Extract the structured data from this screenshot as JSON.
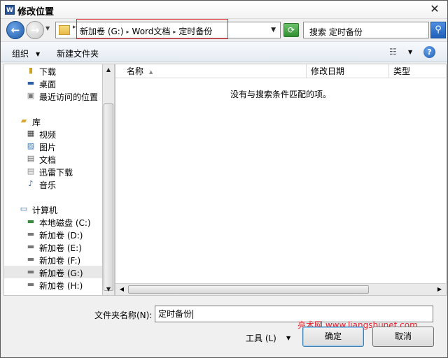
{
  "window": {
    "title": "修改位置",
    "app_icon_text": "W"
  },
  "address": {
    "crumbs": [
      "新加卷 (G:)",
      "Word文档",
      "定时备份"
    ]
  },
  "search": {
    "text": "搜索 定时备份"
  },
  "toolbar": {
    "organize": "组织",
    "new_folder": "新建文件夹",
    "help": "?"
  },
  "nav": {
    "items": [
      {
        "label": "下载",
        "icon": "download-folder-icon"
      },
      {
        "label": "桌面",
        "icon": "desktop-icon"
      },
      {
        "label": "最近访问的位置",
        "icon": "recent-places-icon"
      },
      {
        "label": "库",
        "icon": "library-icon"
      },
      {
        "label": "视频",
        "icon": "video-library-icon"
      },
      {
        "label": "图片",
        "icon": "picture-library-icon"
      },
      {
        "label": "文档",
        "icon": "document-library-icon"
      },
      {
        "label": "迅雷下载",
        "icon": "thunder-download-icon"
      },
      {
        "label": "音乐",
        "icon": "music-library-icon"
      },
      {
        "label": "计算机",
        "icon": "computer-icon"
      },
      {
        "label": "本地磁盘 (C:)",
        "icon": "system-drive-icon"
      },
      {
        "label": "新加卷 (D:)",
        "icon": "drive-icon"
      },
      {
        "label": "新加卷 (E:)",
        "icon": "drive-icon"
      },
      {
        "label": "新加卷 (F:)",
        "icon": "drive-icon"
      },
      {
        "label": "新加卷 (G:)",
        "icon": "drive-icon"
      },
      {
        "label": "新加卷 (H:)",
        "icon": "drive-icon"
      }
    ]
  },
  "columns": [
    "名称",
    "修改日期",
    "类型"
  ],
  "empty_message": "没有与搜索条件匹配的项。",
  "footer": {
    "folder_name_label": "文件夹名称(N):",
    "folder_name_value": "定时备份",
    "tools_label": "工具 (L)",
    "ok_label": "确定",
    "cancel_label": "取消"
  },
  "watermark": "亮术网 www.liangshunet.com",
  "colors": {
    "highlight_border": "#e3232c",
    "watermark": "#e3232c",
    "accent_blue": "#1e5aa8"
  }
}
